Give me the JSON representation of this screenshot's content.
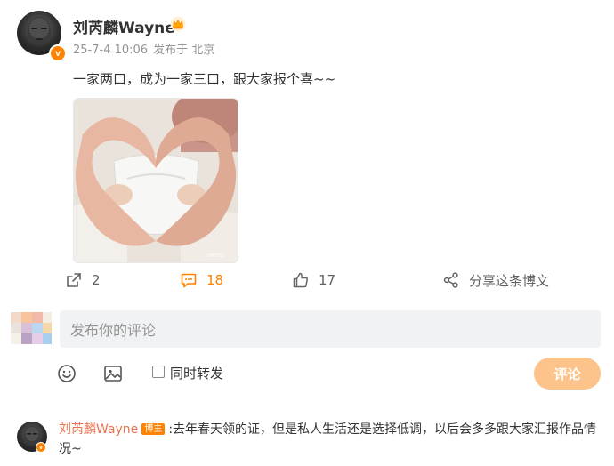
{
  "post": {
    "author": "刘芮麟Wayne",
    "date": "25-7-4 10:06",
    "source": "发布于 北京",
    "text": "一家两口，成为一家三口，跟大家报个喜~~",
    "verified_mark": "v"
  },
  "actions": {
    "repost_count": "2",
    "comment_count": "18",
    "like_count": "17",
    "share_label": "分享这条博文"
  },
  "composer": {
    "placeholder": "发布你的评论",
    "forward_label": "同时转发",
    "submit_label": "评论"
  },
  "comments": [
    {
      "author": "刘芮麟Wayne",
      "tag": "博主",
      "text": ":去年春天领的证，但是私人生活还是选择低调，以后会多多跟大家汇报作品情况~"
    }
  ],
  "colors": {
    "accent": "#ff8200",
    "name_link": "#eb7350",
    "submit_disabled": "#fcc48a"
  },
  "icons": [
    "crown-icon",
    "repost-icon",
    "comment-icon",
    "like-icon",
    "share-icon",
    "emoji-icon",
    "image-icon"
  ]
}
